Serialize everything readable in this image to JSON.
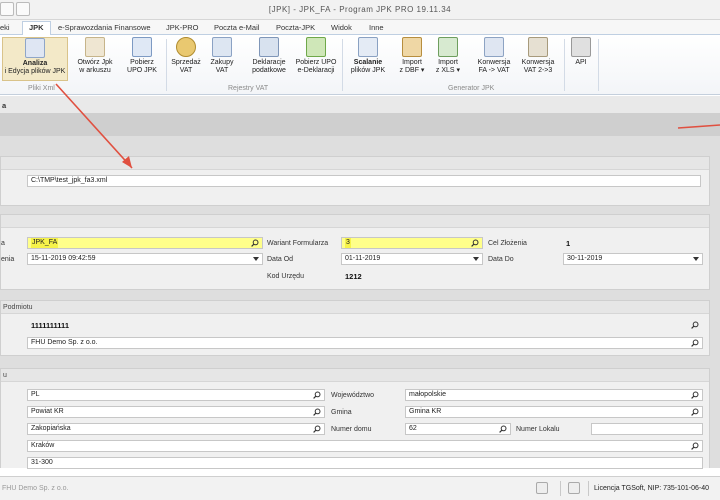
{
  "window": {
    "title": "[JPK] - JPK_FA - Program JPK PRO  19.11.34"
  },
  "menu": {
    "tabs": [
      "eki",
      "JPK",
      "e-Sprawozdania Finansowe",
      "JPK-PRO",
      "Poczta e-Mail",
      "Poczta-JPK",
      "Widok",
      "Inne"
    ],
    "active": "JPK"
  },
  "ribbon": {
    "buttons": [
      {
        "l1": "Analiza",
        "l2": "i Edycja plików JPK"
      },
      {
        "l1": "Otwórz Jpk",
        "l2": "w arkuszu"
      },
      {
        "l1": "Pobierz",
        "l2": "UPO JPK"
      },
      {
        "l1": "Sprzedaż",
        "l2": "VAT"
      },
      {
        "l1": "Zakupy",
        "l2": "VAT"
      },
      {
        "l1": "Deklaracje",
        "l2": "podatkowe"
      },
      {
        "l1": "Pobierz UPO",
        "l2": "e-Deklaracji"
      },
      {
        "l1": "Scalanie",
        "l2": "plików JPK"
      },
      {
        "l1": "Import",
        "l2": "z DBF ▾"
      },
      {
        "l1": "Import",
        "l2": "z XLS ▾"
      },
      {
        "l1": "Konwersja",
        "l2": "FA -> VAT"
      },
      {
        "l1": "Konwersja",
        "l2": "VAT 2->3"
      },
      {
        "l1": "API",
        "l2": ""
      }
    ],
    "groups": [
      "Pliki Xml",
      "Rejestry VAT",
      "Generator JPK"
    ]
  },
  "strip": {
    "label": "a"
  },
  "file": {
    "path": "C:\\TMP\\test_jpk_fa3.xml"
  },
  "header": {
    "label_a": "a",
    "kod": "JPK_FA",
    "label_b": "enia",
    "data_wytworzenia": "15-11-2019 09:42:59",
    "wariant_label": "Wariant Formularza",
    "wariant": "3",
    "cel_label": "Cel Złożenia",
    "cel": "1",
    "data_od_label": "Data Od",
    "data_od": "01-11-2019",
    "data_do_label": "Data Do",
    "data_do": "30-11-2019",
    "kod_urzedu_label": "Kod Urzędu",
    "kod_urzedu": "1212"
  },
  "podmiot": {
    "title": "Podmiotu",
    "nip": "1111111111",
    "nazwa": "FHU Demo Sp. z  o.o."
  },
  "adres": {
    "title": "u",
    "kraj": "PL",
    "wojewodztwo_label": "Województwo",
    "wojewodztwo": "małopolskie",
    "powiat": "Powiat KR",
    "gmina_label": "Gmina",
    "gmina": "Gmina KR",
    "ulica": "Zakopiańska",
    "nr_domu_label": "Numer domu",
    "nr_domu": "62",
    "nr_lokalu_label": "Numer Lokalu",
    "nr_lokalu": "",
    "miejscowosc": "Kraków",
    "kod_pocztowy": "31-300"
  },
  "status": {
    "company": "FHU Demo Sp. z o.o.",
    "license": "Licencja TGSoft,  NIP: 735-101-06-40"
  },
  "colors": {
    "arrow": "#e05040",
    "highlight": "#f6f34a"
  }
}
